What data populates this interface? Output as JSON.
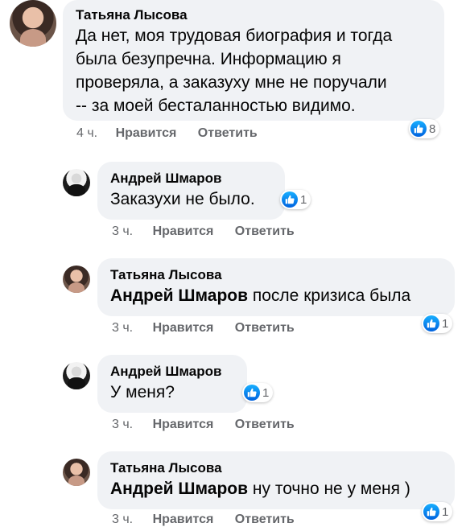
{
  "comments": [
    {
      "author": "Татьяна Лысова",
      "mention": "",
      "lines": [
        "Да нет, моя трудовая биография и тогда",
        "была безупречна. Информацию я",
        "проверяла, а заказуху мне не поручали",
        "-- за моей бесталанностью видимо."
      ],
      "time": "4 ч.",
      "like_label": "Нравится",
      "reply_label": "Ответить",
      "likes": "8",
      "avatar": "tatyana-avatar"
    },
    {
      "author": "Андрей Шмаров",
      "mention": "",
      "lines": [
        "Заказухи не было."
      ],
      "time": "3 ч.",
      "like_label": "Нравится",
      "reply_label": "Ответить",
      "likes": "1",
      "avatar": "andrey-avatar"
    },
    {
      "author": "Татьяна Лысова",
      "mention": "Андрей Шмаров",
      "lines": [
        " после кризиса была"
      ],
      "time": "3 ч.",
      "like_label": "Нравится",
      "reply_label": "Ответить",
      "likes": "1",
      "avatar": "tatyana-avatar"
    },
    {
      "author": "Андрей Шмаров",
      "mention": "",
      "lines": [
        "У меня?"
      ],
      "time": "3 ч.",
      "like_label": "Нравится",
      "reply_label": "Ответить",
      "likes": "1",
      "avatar": "andrey-avatar"
    },
    {
      "author": "Татьяна Лысова",
      "mention": "Андрей Шмаров",
      "lines": [
        " ну точно не у меня )"
      ],
      "time": "3 ч.",
      "like_label": "Нравится",
      "reply_label": "Ответить",
      "likes": "1",
      "avatar": "tatyana-avatar"
    }
  ],
  "colors": {
    "bubble": "#f0f2f5",
    "meta": "#65676b",
    "like": "#1877f2"
  },
  "icons": {
    "like": "thumbs-up-icon"
  }
}
